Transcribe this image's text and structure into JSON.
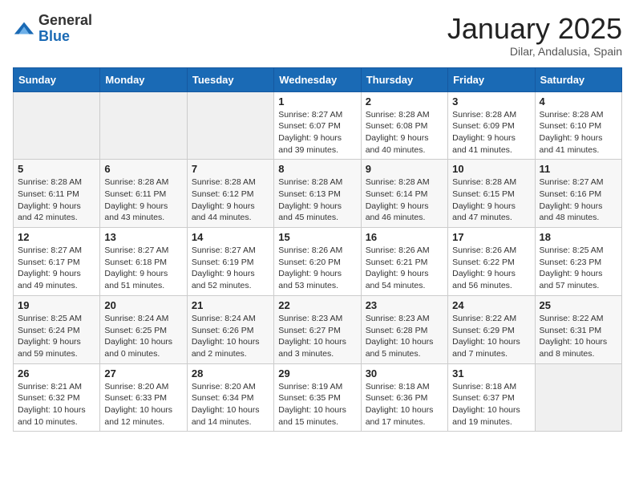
{
  "logo": {
    "general": "General",
    "blue": "Blue"
  },
  "title": "January 2025",
  "location": "Dilar, Andalusia, Spain",
  "days_of_week": [
    "Sunday",
    "Monday",
    "Tuesday",
    "Wednesday",
    "Thursday",
    "Friday",
    "Saturday"
  ],
  "weeks": [
    [
      {
        "day": "",
        "info": ""
      },
      {
        "day": "",
        "info": ""
      },
      {
        "day": "",
        "info": ""
      },
      {
        "day": "1",
        "info": "Sunrise: 8:27 AM\nSunset: 6:07 PM\nDaylight: 9 hours and 39 minutes."
      },
      {
        "day": "2",
        "info": "Sunrise: 8:28 AM\nSunset: 6:08 PM\nDaylight: 9 hours and 40 minutes."
      },
      {
        "day": "3",
        "info": "Sunrise: 8:28 AM\nSunset: 6:09 PM\nDaylight: 9 hours and 41 minutes."
      },
      {
        "day": "4",
        "info": "Sunrise: 8:28 AM\nSunset: 6:10 PM\nDaylight: 9 hours and 41 minutes."
      }
    ],
    [
      {
        "day": "5",
        "info": "Sunrise: 8:28 AM\nSunset: 6:11 PM\nDaylight: 9 hours and 42 minutes."
      },
      {
        "day": "6",
        "info": "Sunrise: 8:28 AM\nSunset: 6:11 PM\nDaylight: 9 hours and 43 minutes."
      },
      {
        "day": "7",
        "info": "Sunrise: 8:28 AM\nSunset: 6:12 PM\nDaylight: 9 hours and 44 minutes."
      },
      {
        "day": "8",
        "info": "Sunrise: 8:28 AM\nSunset: 6:13 PM\nDaylight: 9 hours and 45 minutes."
      },
      {
        "day": "9",
        "info": "Sunrise: 8:28 AM\nSunset: 6:14 PM\nDaylight: 9 hours and 46 minutes."
      },
      {
        "day": "10",
        "info": "Sunrise: 8:28 AM\nSunset: 6:15 PM\nDaylight: 9 hours and 47 minutes."
      },
      {
        "day": "11",
        "info": "Sunrise: 8:27 AM\nSunset: 6:16 PM\nDaylight: 9 hours and 48 minutes."
      }
    ],
    [
      {
        "day": "12",
        "info": "Sunrise: 8:27 AM\nSunset: 6:17 PM\nDaylight: 9 hours and 49 minutes."
      },
      {
        "day": "13",
        "info": "Sunrise: 8:27 AM\nSunset: 6:18 PM\nDaylight: 9 hours and 51 minutes."
      },
      {
        "day": "14",
        "info": "Sunrise: 8:27 AM\nSunset: 6:19 PM\nDaylight: 9 hours and 52 minutes."
      },
      {
        "day": "15",
        "info": "Sunrise: 8:26 AM\nSunset: 6:20 PM\nDaylight: 9 hours and 53 minutes."
      },
      {
        "day": "16",
        "info": "Sunrise: 8:26 AM\nSunset: 6:21 PM\nDaylight: 9 hours and 54 minutes."
      },
      {
        "day": "17",
        "info": "Sunrise: 8:26 AM\nSunset: 6:22 PM\nDaylight: 9 hours and 56 minutes."
      },
      {
        "day": "18",
        "info": "Sunrise: 8:25 AM\nSunset: 6:23 PM\nDaylight: 9 hours and 57 minutes."
      }
    ],
    [
      {
        "day": "19",
        "info": "Sunrise: 8:25 AM\nSunset: 6:24 PM\nDaylight: 9 hours and 59 minutes."
      },
      {
        "day": "20",
        "info": "Sunrise: 8:24 AM\nSunset: 6:25 PM\nDaylight: 10 hours and 0 minutes."
      },
      {
        "day": "21",
        "info": "Sunrise: 8:24 AM\nSunset: 6:26 PM\nDaylight: 10 hours and 2 minutes."
      },
      {
        "day": "22",
        "info": "Sunrise: 8:23 AM\nSunset: 6:27 PM\nDaylight: 10 hours and 3 minutes."
      },
      {
        "day": "23",
        "info": "Sunrise: 8:23 AM\nSunset: 6:28 PM\nDaylight: 10 hours and 5 minutes."
      },
      {
        "day": "24",
        "info": "Sunrise: 8:22 AM\nSunset: 6:29 PM\nDaylight: 10 hours and 7 minutes."
      },
      {
        "day": "25",
        "info": "Sunrise: 8:22 AM\nSunset: 6:31 PM\nDaylight: 10 hours and 8 minutes."
      }
    ],
    [
      {
        "day": "26",
        "info": "Sunrise: 8:21 AM\nSunset: 6:32 PM\nDaylight: 10 hours and 10 minutes."
      },
      {
        "day": "27",
        "info": "Sunrise: 8:20 AM\nSunset: 6:33 PM\nDaylight: 10 hours and 12 minutes."
      },
      {
        "day": "28",
        "info": "Sunrise: 8:20 AM\nSunset: 6:34 PM\nDaylight: 10 hours and 14 minutes."
      },
      {
        "day": "29",
        "info": "Sunrise: 8:19 AM\nSunset: 6:35 PM\nDaylight: 10 hours and 15 minutes."
      },
      {
        "day": "30",
        "info": "Sunrise: 8:18 AM\nSunset: 6:36 PM\nDaylight: 10 hours and 17 minutes."
      },
      {
        "day": "31",
        "info": "Sunrise: 8:18 AM\nSunset: 6:37 PM\nDaylight: 10 hours and 19 minutes."
      },
      {
        "day": "",
        "info": ""
      }
    ]
  ]
}
